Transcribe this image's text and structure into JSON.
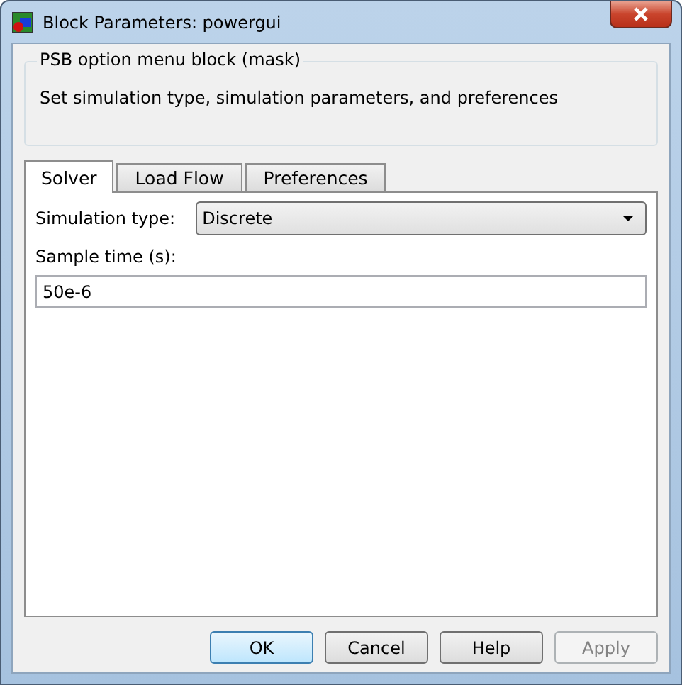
{
  "window": {
    "title": "Block Parameters: powergui"
  },
  "group": {
    "title": "PSB option menu block (mask)",
    "description": "Set simulation type, simulation parameters, and preferences"
  },
  "tabs": [
    {
      "label": "Solver",
      "selected": true
    },
    {
      "label": "Load Flow",
      "selected": false
    },
    {
      "label": "Preferences",
      "selected": false
    }
  ],
  "fields": [
    {
      "kind": "dropdown",
      "label": "Simulation type:",
      "value": "Discrete"
    },
    {
      "kind": "text",
      "label": "Sample time (s):",
      "value": "50e-6"
    }
  ],
  "buttons": [
    {
      "label": "OK",
      "default": true,
      "disabled": false
    },
    {
      "label": "Cancel",
      "default": false,
      "disabled": false
    },
    {
      "label": "Help",
      "default": false,
      "disabled": false
    },
    {
      "label": "Apply",
      "default": false,
      "disabled": true
    }
  ]
}
